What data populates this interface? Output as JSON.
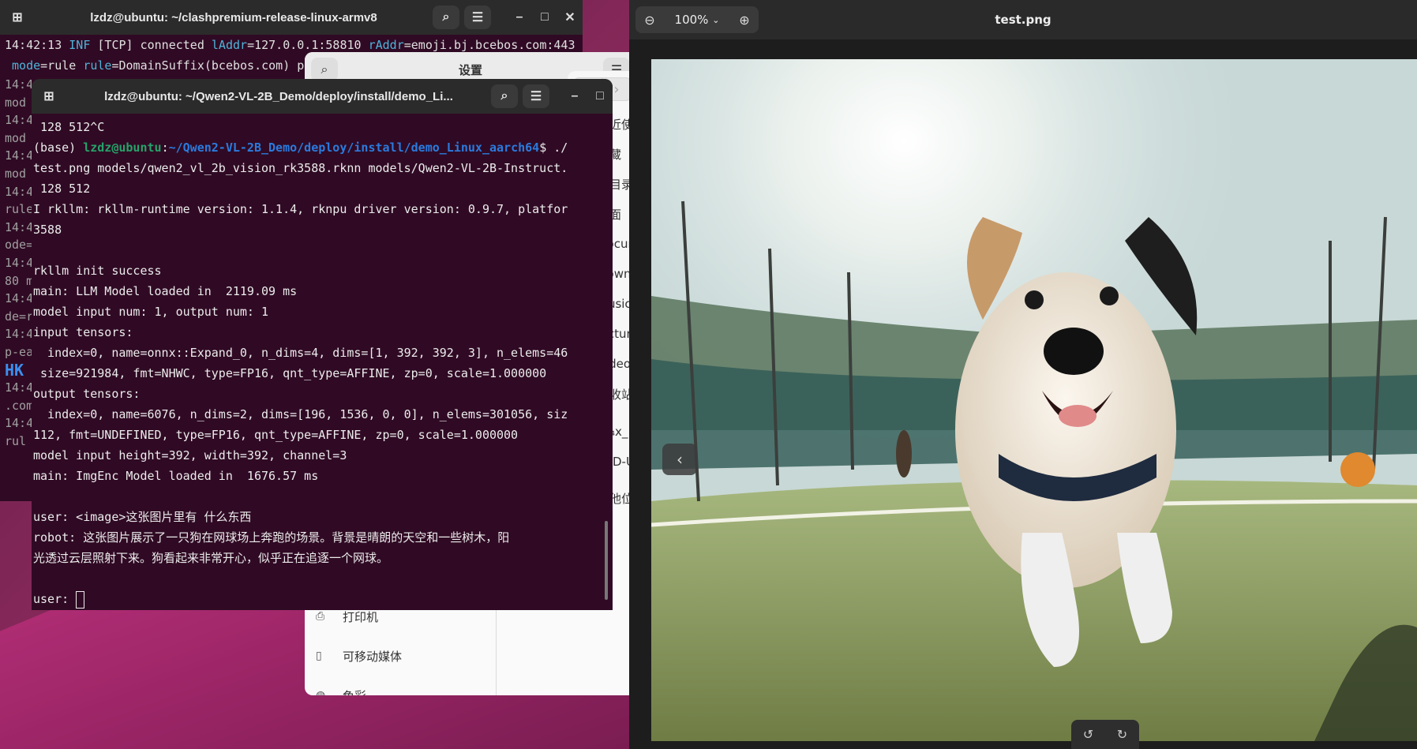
{
  "back_terminal": {
    "title": "lzdz@ubuntu: ~/clashpremium-release-linux-armv8",
    "line1_time": "14:42:13",
    "line1_level": "INF",
    "line1_text": "[TCP] connected",
    "line1_laddr_key": "lAddr",
    "line1_laddr_val": "=127.0.0.1:58810",
    "line1_raddr_key": "rAddr",
    "line1_raddr_val": "=emoji.bj.bcebos.com:443",
    "line2_mode_key": "mode",
    "line2_mode_val": "=rule",
    "line2_rule_key": "rule",
    "line2_rule_val": "=DomainSuffix(bcebos.com)",
    "line2_tail": "p",
    "left_fragments": [
      "14:4",
      "mod",
      "14:4",
      "mod",
      "14:4",
      "mod",
      "14:4",
      "rule",
      "14:4",
      "ode=",
      "14:4",
      "80 m",
      "14:4",
      "de=r",
      "14:4",
      "p-ea",
      "HK",
      "14:4",
      ".com",
      "14:4",
      "rul"
    ]
  },
  "settings_window": {
    "title": "设置",
    "items": [
      {
        "label": "打印机",
        "icon": "printer-icon"
      },
      {
        "label": "可移动媒体",
        "icon": "usb-icon"
      },
      {
        "label": "色彩",
        "icon": "palette-icon"
      }
    ]
  },
  "files_window": {
    "items": [
      {
        "label": "最近使",
        "icon": "clock-icon"
      },
      {
        "label": "收藏",
        "icon": "star-icon"
      },
      {
        "label": "主目录",
        "icon": "home-icon"
      },
      {
        "label": "桌面",
        "icon": "desktop-icon"
      },
      {
        "label": "Docum",
        "icon": "document-icon"
      },
      {
        "label": "Downl",
        "icon": "download-icon"
      },
      {
        "label": "Music",
        "icon": "music-icon"
      },
      {
        "label": "Pictur",
        "icon": "pictures-icon"
      },
      {
        "label": "Video",
        "icon": "video-icon"
      },
      {
        "label": "回收站",
        "icon": "trash-icon"
      },
      {
        "label": "_¼x_",
        "icon": "drive-icon"
      },
      {
        "label": "ESD-U",
        "icon": "drive-icon"
      },
      {
        "label": "其他位",
        "icon": "plus-icon"
      }
    ]
  },
  "front_terminal": {
    "title": "lzdz@ubuntu: ~/Qwen2-VL-2B_Demo/deploy/install/demo_Li...",
    "lines": [
      " 128 512^C",
      "__PROMPT__",
      "test.png models/qwen2_vl_2b_vision_rk3588.rknn models/Qwen2-VL-2B-Instruct.",
      " 128 512",
      "I rkllm: rkllm-runtime version: 1.1.4, rknpu driver version: 0.9.7, platfor",
      "3588",
      "",
      "rkllm init success",
      "main: LLM Model loaded in  2119.09 ms",
      "model input num: 1, output num: 1",
      "input tensors:",
      "  index=0, name=onnx::Expand_0, n_dims=4, dims=[1, 392, 392, 3], n_elems=46",
      " size=921984, fmt=NHWC, type=FP16, qnt_type=AFFINE, zp=0, scale=1.000000",
      "output tensors:",
      "  index=0, name=6076, n_dims=2, dims=[196, 1536, 0, 0], n_elems=301056, siz",
      "112, fmt=UNDEFINED, type=FP16, qnt_type=AFFINE, zp=0, scale=1.000000",
      "model input height=392, width=392, channel=3",
      "main: ImgEnc Model loaded in  1676.57 ms",
      "",
      "user: <image>这张图片里有 什么东西",
      "robot: 这张图片展示了一只狗在网球场上奔跑的场景。背景是晴朗的天空和一些树木，阳",
      "光透过云层照射下来。狗看起来非常开心，似乎正在追逐一个网球。",
      ""
    ],
    "prompt_env": "(base) ",
    "prompt_user": "lzdz@ubuntu",
    "prompt_sep": ":",
    "prompt_path": "~/Qwen2-VL-2B_Demo/deploy/install/demo_Linux_aarch64",
    "prompt_tail": "$ ./",
    "input_prefix": "user: "
  },
  "image_viewer": {
    "title": "test.png",
    "zoom": "100%"
  }
}
